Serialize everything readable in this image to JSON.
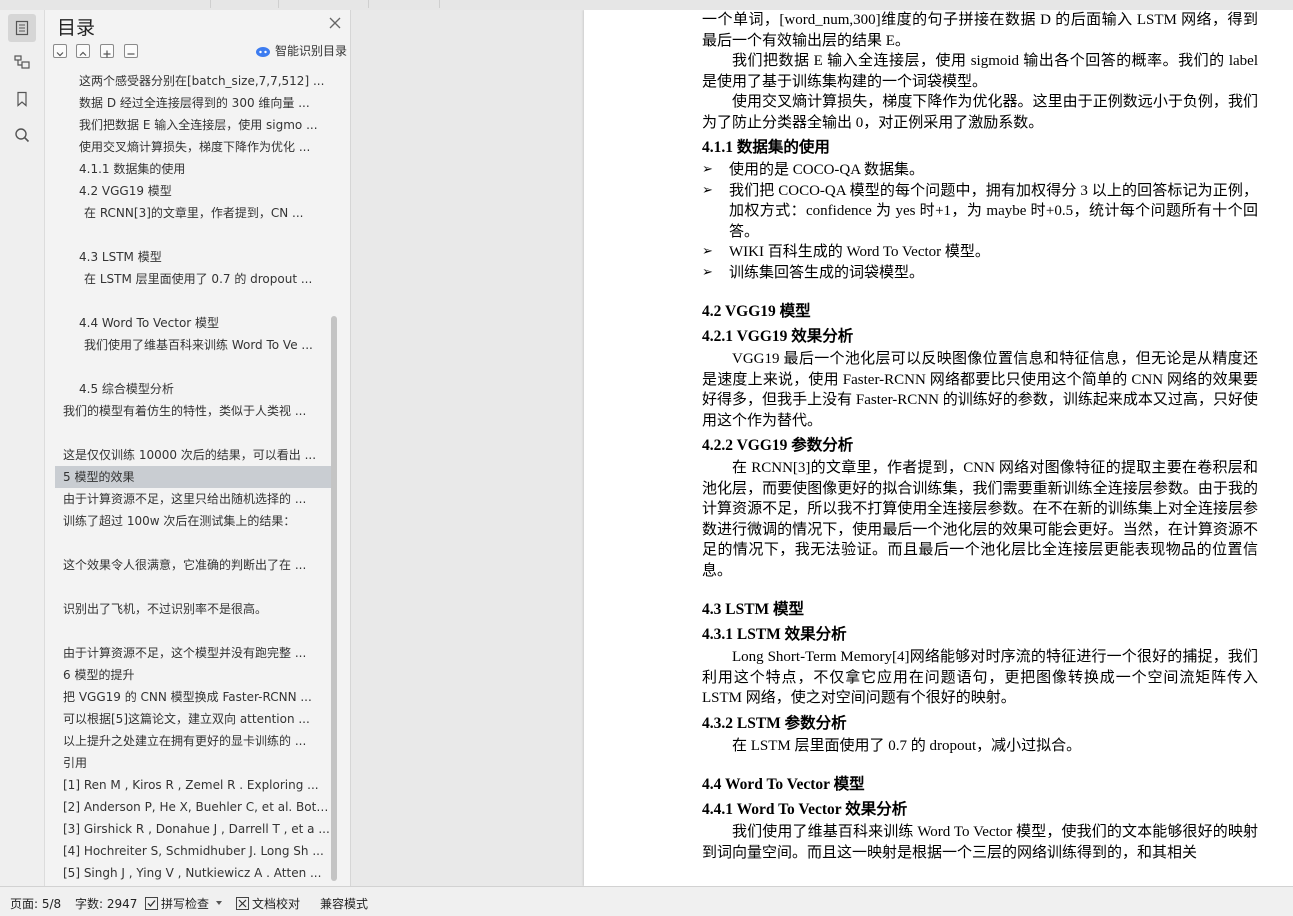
{
  "toc": {
    "title": "目录",
    "smart_label": "智能识别目录",
    "items": [
      {
        "text": "这两个感受器分别在[batch_size,7,7,512] ...",
        "level": 3
      },
      {
        "text": "数据 D 经过全连接层得到的 300 维向量 ...",
        "level": 3
      },
      {
        "text": "我们把数据 E 输入全连接层，使用 sigmo ...",
        "level": 3
      },
      {
        "text": "使用交叉熵计算损失，梯度下降作为优化 ...",
        "level": 3
      },
      {
        "text": "4.1.1  数据集的使用",
        "level": 3
      },
      {
        "text": "4.2 VGG19 模型",
        "level": 3
      },
      {
        "text": "在 RCNN[3]的文章里，作者提到，CN ...",
        "level": 4
      },
      {
        "text": "4.3 LSTM 模型",
        "level": 3
      },
      {
        "text": "在 LSTM 层里面使用了 0.7 的 dropout ...",
        "level": 4
      },
      {
        "text": "4.4 Word To Vector 模型",
        "level": 3
      },
      {
        "text": "我们使用了维基百科来训练 Word To Ve ...",
        "level": 4
      },
      {
        "text": "4.5  综合模型分析",
        "level": 3
      },
      {
        "text": "我们的模型有着仿生的特性，类似于人类视 ...",
        "level": 1
      },
      {
        "text": "这是仅仅训练 10000 次后的结果，可以看出 ...",
        "level": 1
      },
      {
        "text": "5  模型的效果",
        "level": 1
      },
      {
        "text": "由于计算资源不足，这里只给出随机选择的 ...",
        "level": 1
      },
      {
        "text": "训练了超过 100w 次后在测试集上的结果：",
        "level": 1
      },
      {
        "text": "这个效果令人很满意，它准确的判断出了在 ...",
        "level": 1
      },
      {
        "text": "识别出了飞机，不过识别率不是很高。",
        "level": 1
      },
      {
        "text": "由于计算资源不足，这个模型并没有跑完整 ...",
        "level": 1
      },
      {
        "text": "6  模型的提升",
        "level": 1
      },
      {
        "text": "把 VGG19 的 CNN 模型换成 Faster-RCNN ...",
        "level": 1
      },
      {
        "text": "可以根据[5]这篇论文，建立双向 attention ...",
        "level": 1
      },
      {
        "text": "以上提升之处建立在拥有更好的显卡训练的 ...",
        "level": 1
      },
      {
        "text": "引用",
        "level": 1
      },
      {
        "text": "[1] Ren M , Kiros R , Zemel R . Exploring  ...",
        "level": 1
      },
      {
        "text": "[2] Anderson P, He X, Buehler C, et al. Bot ...",
        "level": 1
      },
      {
        "text": "[3] Girshick R , Donahue J , Darrell T , et a ...",
        "level": 1
      },
      {
        "text": "[4] Hochreiter S, Schmidhuber J. Long Sh ...",
        "level": 1
      },
      {
        "text": "[5] Singh J , Ying V , Nutkiewicz A . Atten ...",
        "level": 1
      }
    ]
  },
  "doc": {
    "p1": "一个单词，[word_num,300]维度的句子拼接在数据 D 的后面输入 LSTM 网络，得到最后一个有效输出层的结果 E。",
    "p2": "我们把数据 E 输入全连接层，使用 sigmoid 输出各个回答的概率。我们的 label 是使用了基于训练集构建的一个词袋模型。",
    "p3": "使用交叉熵计算损失，梯度下降作为优化器。这里由于正例数远小于负例，我们为了防止分类器全输出 0，对正例采用了激励系数。",
    "h411": "4.1.1  数据集的使用",
    "li1": "使用的是 COCO-QA 数据集。",
    "li2": "我们把 COCO-QA 模型的每个问题中，拥有加权得分 3 以上的回答标记为正例，加权方式：confidence 为 yes 时+1，为 maybe 时+0.5，统计每个问题所有十个回答。",
    "li3": "WIKI 百科生成的 Word To Vector 模型。",
    "li4": "训练集回答生成的词袋模型。",
    "h42": "4.2 VGG19 模型",
    "h421": "4.2.1 VGG19  效果分析",
    "p421": "VGG19 最后一个池化层可以反映图像位置信息和特征信息，但无论是从精度还是速度上来说，使用 Faster-RCNN 网络都要比只使用这个简单的 CNN 网络的效果要好得多，但我手上没有 Faster-RCNN 的训练好的参数，训练起来成本又过高，只好使用这个作为替代。",
    "h422": "4.2.2 VGG19  参数分析",
    "p422": "在 RCNN[3]的文章里，作者提到，CNN 网络对图像特征的提取主要在卷积层和池化层，而要使图像更好的拟合训练集，我们需要重新训练全连接层参数。由于我的计算资源不足，所以我不打算使用全连接层参数。在不在新的训练集上对全连接层参数进行微调的情况下，使用最后一个池化层的效果可能会更好。当然，在计算资源不足的情况下，我无法验证。而且最后一个池化层比全连接层更能表现物品的位置信息。",
    "h43": "4.3 LSTM 模型",
    "h431": "4.3.1 LSTM  效果分析",
    "p431": "Long Short-Term Memory[4]网络能够对时序流的特征进行一个很好的捕捉，我们利用这个特点，不仅拿它应用在问题语句，更把图像转换成一个空间流矩阵传入 LSTM 网络，使之对空间问题有个很好的映射。",
    "h432": "4.3.2 LSTM  参数分析",
    "p432": "在 LSTM 层里面使用了 0.7 的 dropout，减小过拟合。",
    "h44": "4.4 Word To Vector 模型",
    "h441": "4.4.1 Word To Vector  效果分析",
    "p441": "我们使用了维基百科来训练 Word To Vector 模型，使我们的文本能够很好的映射到词向量空间。而且这一映射是根据一个三层的网络训练得到的，和其相关"
  },
  "status": {
    "page": "页面: 5/8",
    "words": "字数: 2947",
    "spell": "拼写检查",
    "proof": "文档校对",
    "compat": "兼容模式"
  }
}
